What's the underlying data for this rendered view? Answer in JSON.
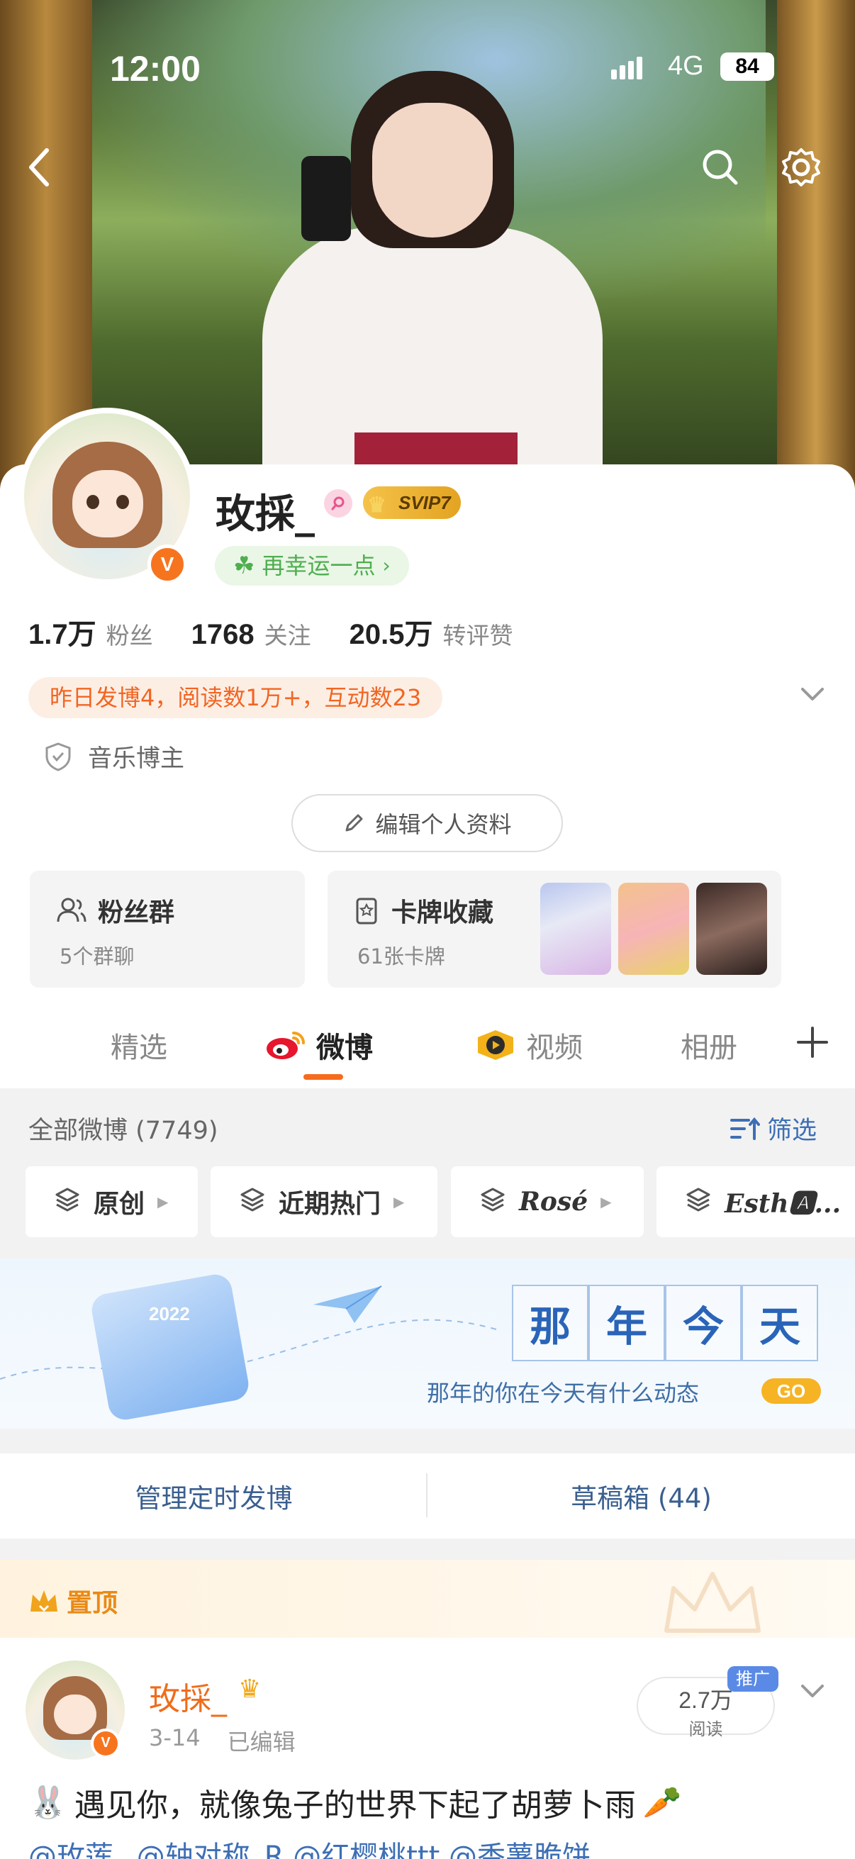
{
  "status_bar": {
    "time": "12:00",
    "network": "4G",
    "battery": "84"
  },
  "profile": {
    "name": "玫採_",
    "svip_label": "SVIP7",
    "verified_mark": "V",
    "luck_label": "再幸运一点",
    "stats": [
      {
        "value": "1.7万",
        "label": "粉丝"
      },
      {
        "value": "1768",
        "label": "关注"
      },
      {
        "value": "20.5万",
        "label": "转评赞"
      }
    ],
    "activity": "昨日发博4，阅读数1万+，互动数23",
    "tag": "音乐博主",
    "edit_label": "编辑个人资料"
  },
  "boxes": {
    "fans_title": "粉丝群",
    "fans_sub": "5个群聊",
    "cards_title": "卡牌收藏",
    "cards_sub": "61张卡牌"
  },
  "tabs": [
    {
      "label": "精选",
      "active": false
    },
    {
      "label": "微博",
      "active": true
    },
    {
      "label": "视频",
      "active": false
    },
    {
      "label": "相册",
      "active": false
    }
  ],
  "feed": {
    "all_count": "全部微博 (7749)",
    "filter_label": "筛选",
    "pills": [
      "原创",
      "近期热门",
      "Rosé",
      "Esth🅰..."
    ]
  },
  "banner": {
    "year": "2022",
    "chars": [
      "那",
      "年",
      "今",
      "天"
    ],
    "subtitle": "那年的你在今天有什么动态",
    "go": "GO"
  },
  "actions": {
    "scheduled": "管理定时发博",
    "drafts": "草稿箱 (44)"
  },
  "post": {
    "pinned_label": "置顶",
    "author": "玫採_",
    "date": "3-14",
    "edited": "已编辑",
    "reads_value": "2.7万",
    "reads_unit": "阅读",
    "promo": "推广",
    "text": "遇见你，就像兔子的世界下起了胡萝卜雨",
    "mentions": "@玫莲_ @轴对称_R @红樱桃ttt @香薯脆饼"
  },
  "colors": {
    "accent": "#f76b1c",
    "link": "#3d6fb5",
    "activity_bg": "#fdeee4"
  }
}
